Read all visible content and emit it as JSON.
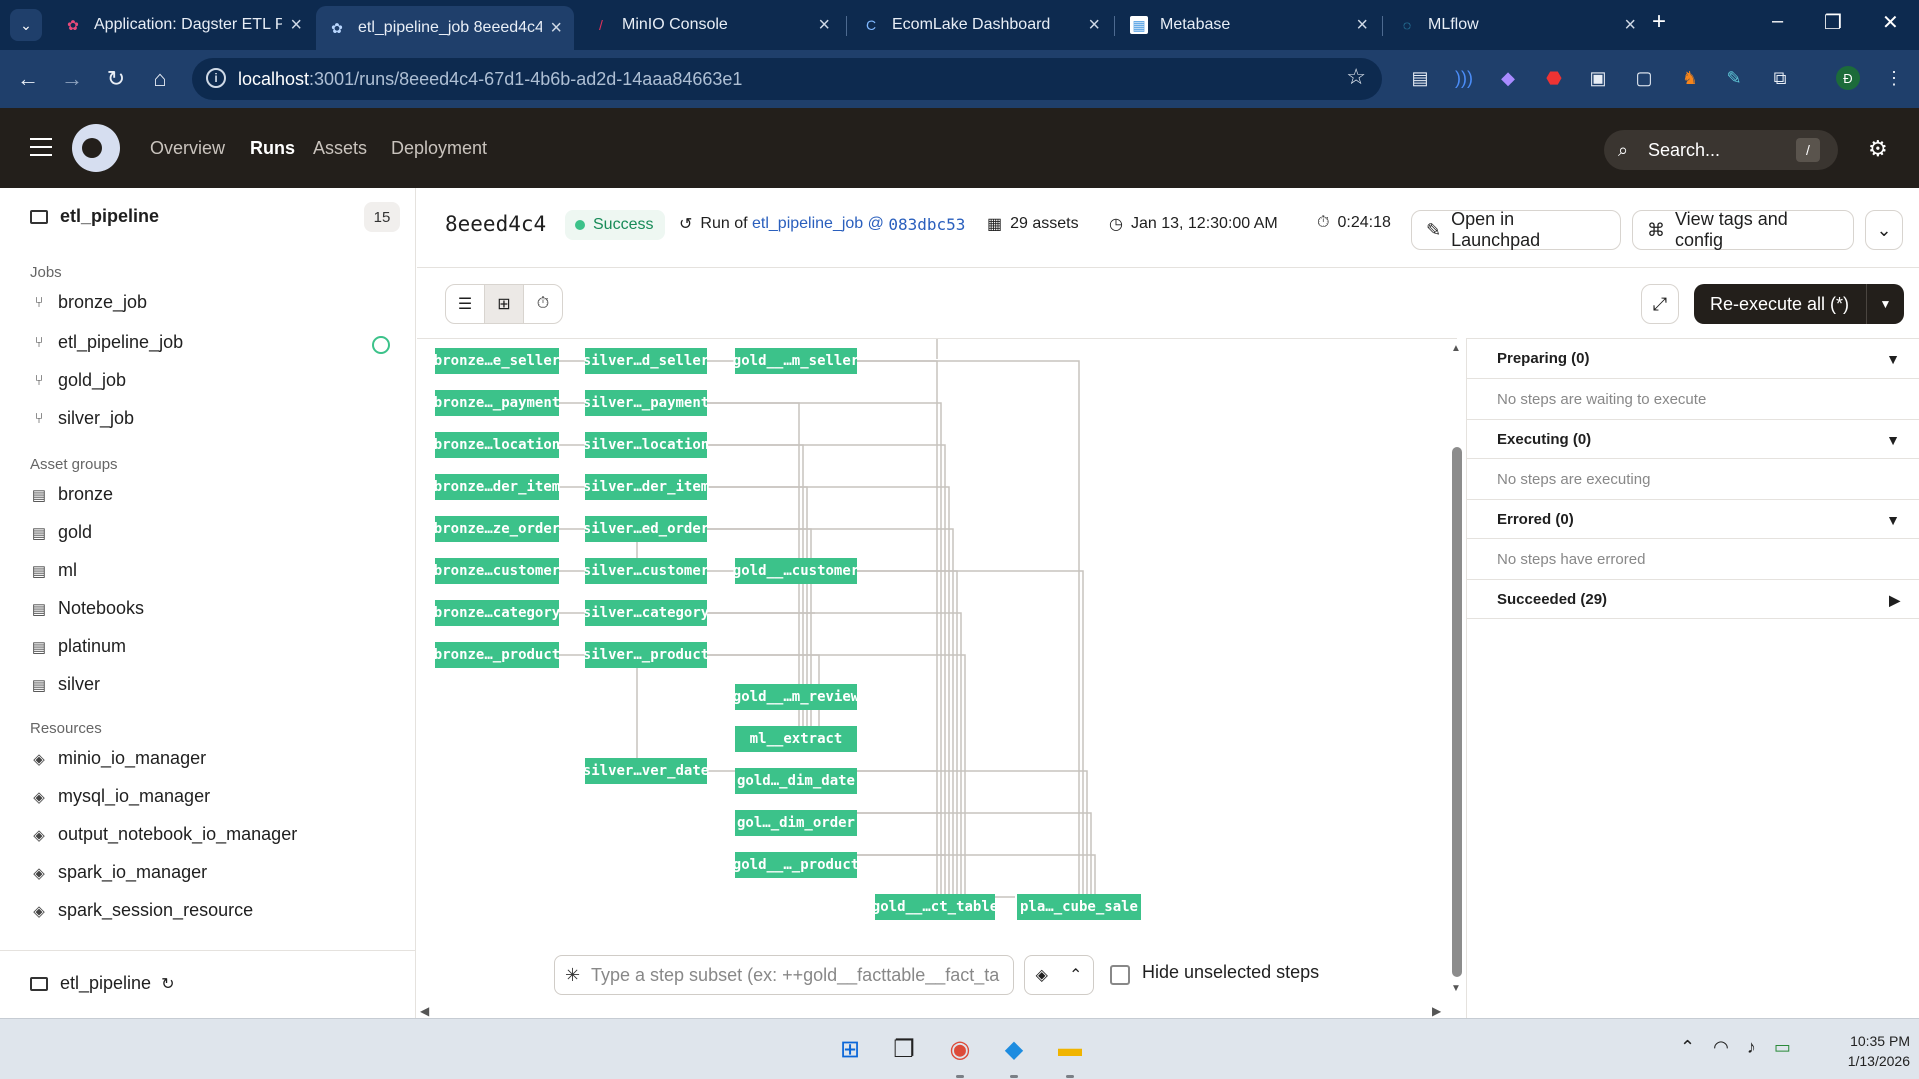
{
  "browser": {
    "tabs": [
      {
        "title": "Application: Dagster ETL Pi",
        "icon": "dagster-icon"
      },
      {
        "title": "etl_pipeline_job 8eeed4c4 |",
        "icon": "dagster-icon",
        "active": true
      },
      {
        "title": "MinIO Console",
        "icon": "minio-icon"
      },
      {
        "title": "EcomLake Dashboard",
        "icon": "ecomlake-icon"
      },
      {
        "title": "Metabase",
        "icon": "metabase-icon"
      },
      {
        "title": "MLflow",
        "icon": "mlflow-icon"
      }
    ],
    "url_host": "localhost",
    "url_rest": ":3001/runs/8eeed4c4-67d1-4b6b-ad2d-14aaa84663e1"
  },
  "nav": {
    "links": [
      "Overview",
      "Runs",
      "Assets",
      "Deployment"
    ],
    "active": "Runs",
    "search_placeholder": "Search...",
    "search_shortcut": "/"
  },
  "sidebar": {
    "repo": "etl_pipeline",
    "repo_count": "15",
    "jobs_title": "Jobs",
    "jobs": [
      "bronze_job",
      "etl_pipeline_job",
      "gold_job",
      "silver_job"
    ],
    "asset_groups_title": "Asset groups",
    "asset_groups": [
      "bronze",
      "gold",
      "ml",
      "Notebooks",
      "platinum",
      "silver"
    ],
    "resources_title": "Resources",
    "resources": [
      "minio_io_manager",
      "mysql_io_manager",
      "output_notebook_io_manager",
      "spark_io_manager",
      "spark_session_resource"
    ],
    "footer_repo": "etl_pipeline"
  },
  "run": {
    "id": "8eeed4c4",
    "status": "Success",
    "run_of_prefix": "Run of",
    "job_name": "etl_pipeline_job",
    "at": "@",
    "snapshot": "083dbc53",
    "assets": "29 assets",
    "started": "Jan 13, 12:30:00 AM",
    "duration": "0:24:18",
    "open_launchpad": "Open in Launchpad",
    "view_tags": "View tags and config",
    "reexecute": "Re-execute all (*)"
  },
  "graph": {
    "nodes": {
      "bronze": [
        "bronze…e_seller",
        "bronze…_payment",
        "bronze…location",
        "bronze…der_item",
        "bronze…ze_order",
        "bronze…customer",
        "bronze…category",
        "bronze…_product"
      ],
      "silver": [
        "silver…d_seller",
        "silver…_payment",
        "silver…location",
        "silver…der_item",
        "silver…ed_order",
        "silver…customer",
        "silver…category",
        "silver…_product",
        "silver…ver_date"
      ],
      "gold": [
        "gold__…m_seller",
        "gold__…customer",
        "gold__…m_review",
        "ml__extract",
        "gold…_dim_date",
        "gol…_dim_order",
        "gold__…_product",
        "gold__…ct_table"
      ],
      "platinum": [
        "pla…_cube_sale"
      ]
    },
    "subset_placeholder": "Type a step subset (ex: ++gold__facttable__fact_ta",
    "hide_unselected": "Hide unselected steps"
  },
  "steps": {
    "preparing": "Preparing (0)",
    "preparing_empty": "No steps are waiting to execute",
    "executing": "Executing (0)",
    "executing_empty": "No steps are executing",
    "errored": "Errored (0)",
    "errored_empty": "No steps have errored",
    "succeeded": "Succeeded (29)"
  },
  "taskbar": {
    "time": "10:35 PM",
    "date": "1/13/2026"
  },
  "colors": {
    "node": "#3cc28a",
    "nav_bg": "#231f1b",
    "browser_bg": "#0d2a4f"
  }
}
